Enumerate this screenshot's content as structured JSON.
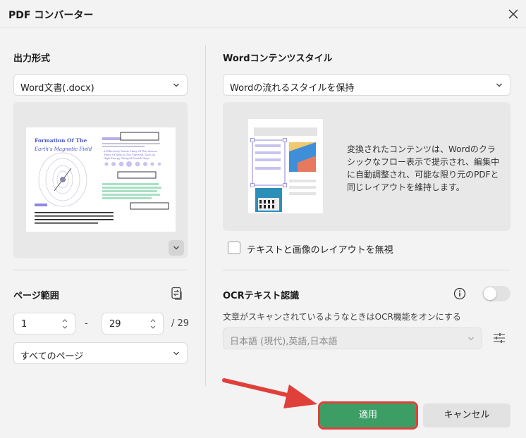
{
  "dialog": {
    "title": "PDF コンバーター"
  },
  "left": {
    "output_format": {
      "heading": "出力形式",
      "selected": "Word文書(.docx)"
    },
    "preview": {
      "doc_title_line1": "Formation Of The",
      "doc_title_line2": "Earth's Magnetic Field"
    },
    "page_range": {
      "heading": "ページ範囲",
      "from": "1",
      "dash": "-",
      "to": "29",
      "total": "/ 29",
      "pages_option": "すべてのページ"
    }
  },
  "right": {
    "word_style": {
      "heading": "Wordコンテンツスタイル",
      "selected": "Wordの流れるスタイルを保持",
      "description": "変換されたコンテンツは、Wordのクラシックなフロー表示で提示され、編集中に自動調整され、可能な限り元のPDFと同じレイアウトを維持します。"
    },
    "ignore_layout": {
      "label": "テキストと画像のレイアウトを無視",
      "checked": false
    },
    "ocr": {
      "heading": "OCRテキスト認識",
      "enabled": false,
      "description": "文章がスキャンされているようなときはOCR機能をオンにする",
      "languages": "日本語 (現代),英語,日本語"
    }
  },
  "footer": {
    "apply_label": "適用",
    "cancel_label": "キャンセル"
  },
  "colors": {
    "accent_green": "#3c9e65",
    "highlight_red": "#e0403a"
  }
}
